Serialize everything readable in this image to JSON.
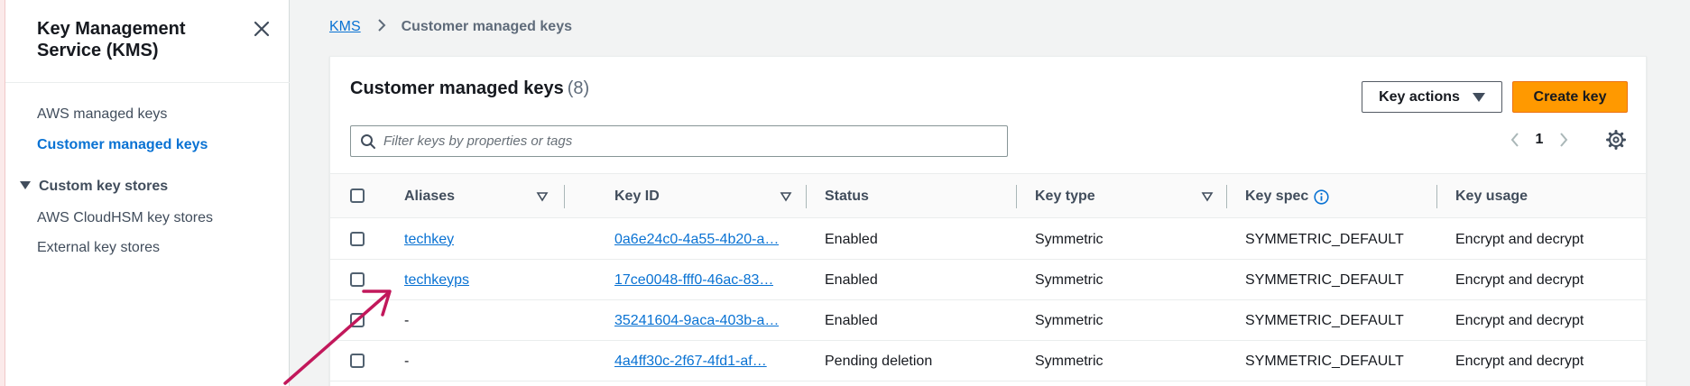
{
  "sidebar": {
    "title": "Key Management Service (KMS)",
    "items": [
      {
        "label": "AWS managed keys",
        "active": false
      },
      {
        "label": "Customer managed keys",
        "active": true
      }
    ],
    "section": {
      "label": "Custom key stores",
      "items": [
        {
          "label": "AWS CloudHSM key stores"
        },
        {
          "label": "External key stores"
        }
      ]
    }
  },
  "breadcrumb": {
    "root": "KMS",
    "current": "Customer managed keys"
  },
  "panel": {
    "title": "Customer managed keys",
    "count": "(8)",
    "actions_label": "Key actions",
    "create_label": "Create key",
    "search_placeholder": "Filter keys by properties or tags",
    "page": "1"
  },
  "table": {
    "columns": [
      "Aliases",
      "Key ID",
      "Status",
      "Key type",
      "Key spec",
      "Key usage"
    ],
    "rows": [
      {
        "alias": "techkey",
        "alias_link": true,
        "key_id": "0a6e24c0-4a55-4b20-a…",
        "status": "Enabled",
        "key_type": "Symmetric",
        "key_spec": "SYMMETRIC_DEFAULT",
        "key_usage": "Encrypt and decrypt"
      },
      {
        "alias": "techkeyps",
        "alias_link": true,
        "key_id": "17ce0048-fff0-46ac-83…",
        "status": "Enabled",
        "key_type": "Symmetric",
        "key_spec": "SYMMETRIC_DEFAULT",
        "key_usage": "Encrypt and decrypt"
      },
      {
        "alias": "-",
        "alias_link": false,
        "key_id": "35241604-9aca-403b-a…",
        "status": "Enabled",
        "key_type": "Symmetric",
        "key_spec": "SYMMETRIC_DEFAULT",
        "key_usage": "Encrypt and decrypt"
      },
      {
        "alias": "-",
        "alias_link": false,
        "key_id": "4a4ff30c-2f67-4fd1-af…",
        "status": "Pending deletion",
        "key_type": "Symmetric",
        "key_spec": "SYMMETRIC_DEFAULT",
        "key_usage": "Encrypt and decrypt"
      }
    ]
  },
  "colors": {
    "link": "#0972d3",
    "primary_button": "#ff9900",
    "annotation_arrow": "#c2185b"
  }
}
